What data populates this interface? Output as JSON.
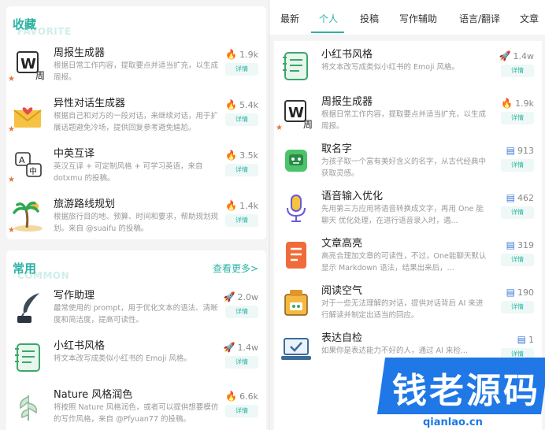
{
  "favorites": {
    "title": "收藏",
    "subtitle": "FAVORITE",
    "items": [
      {
        "title": "周报生成器",
        "desc": "根据日常工作内容，提取要点并适当扩充，以生成周报。",
        "stat": "1.9k",
        "stat_icon": "fire-icon",
        "btn": "详情"
      },
      {
        "title": "异性对话生成器",
        "desc": "根据自己和对方的一段对话，来继续对话，用于扩展话题避免冷场，提供回复参考避免尴尬。",
        "stat": "5.4k",
        "stat_icon": "fire-icon",
        "btn": "详情"
      },
      {
        "title": "中英互译",
        "desc": "英汉互译 + 可定制风格 + 可学习英语，来自 dotxmu 的投稿。",
        "stat": "3.5k",
        "stat_icon": "fire-icon",
        "btn": "详情"
      },
      {
        "title": "旅游路线规划",
        "desc": "根据旅行目的地、预算、时间和要求，帮助规划规划。来自 @suaifu 的投稿。",
        "stat": "1.4k",
        "stat_icon": "fire-icon",
        "btn": "详情"
      }
    ]
  },
  "common": {
    "title": "常用",
    "subtitle": "COMMON",
    "more": "查看更多>",
    "items": [
      {
        "title": "写作助理",
        "desc": "最常使用的 prompt，用于优化文本的语法、清晰度和简洁度，提高可读性。",
        "stat": "2.0w",
        "stat_icon": "rocket-icon",
        "btn": "详情"
      },
      {
        "title": "小红书风格",
        "desc": "将文本改写成类似小红书的 Emoji 风格。",
        "stat": "1.4w",
        "stat_icon": "rocket-icon",
        "btn": "详情"
      },
      {
        "title": "Nature 风格润色",
        "desc": "将按照 Nature 风格润色，或者可以提供想要模仿的写作风格，来自 @Pfyuan77 的投稿。",
        "stat": "6.6k",
        "stat_icon": "fire-icon",
        "btn": "详情"
      }
    ]
  },
  "tabs": [
    "最新",
    "个人",
    "投稿",
    "写作辅助",
    "语言/翻译",
    "文章"
  ],
  "active_tab": "个人",
  "right_list": [
    {
      "title": "小红书风格",
      "desc": "将文本改写成类似小红书的 Emoji 风格。",
      "stat": "1.4w",
      "stat_icon": "rocket-icon",
      "btn": "详情"
    },
    {
      "title": "周报生成器",
      "desc": "根据日常工作内容，提取要点并适当扩充，以生成周报。",
      "stat": "1.9k",
      "stat_icon": "fire-icon",
      "btn": "详情"
    },
    {
      "title": "取名字",
      "desc": "为孩子取一个富有美好含义的名字，从古代经典中获取灵感。",
      "stat": "913",
      "stat_icon": "chip-icon",
      "btn": "详情"
    },
    {
      "title": "语音输入优化",
      "desc": "先用第三方应用将语音转换成文字，再用 One 能聊天 优化处理，在进行语音录入时，遇...",
      "stat": "462",
      "stat_icon": "chip-icon",
      "btn": "详情"
    },
    {
      "title": "文章高亮",
      "desc": "高亮合理加文章的可读性，不过，One能聊天默认显示 Markdown 语法，结果出来后，...",
      "stat": "319",
      "stat_icon": "chip-icon",
      "btn": "详情"
    },
    {
      "title": "阅读空气",
      "desc": "对于一些无法理解的对话，提供对话背后 AI 来进行解读并制定出适当的回应。",
      "stat": "190",
      "stat_icon": "chip-icon",
      "btn": "详情"
    },
    {
      "title": "表达自检",
      "desc": "如果你是表达能力不好的人，通过 AI 来检...",
      "stat": "1",
      "stat_icon": "chip-icon",
      "btn": "详情"
    }
  ],
  "watermark": {
    "text": "钱老源码",
    "url": "qianlao.cn"
  },
  "colors": {
    "accent": "#2bb3a3",
    "brand_blue": "#1f78e6",
    "fire": "#f07a2d"
  }
}
